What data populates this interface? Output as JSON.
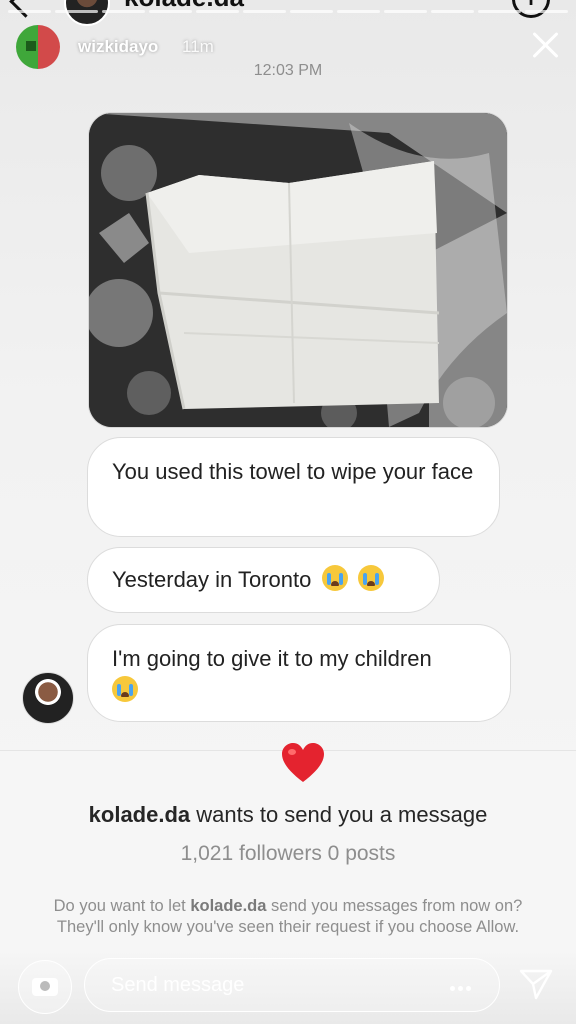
{
  "dm_header": {
    "username": "kolade.da",
    "info_label": "i"
  },
  "story": {
    "username": "wizkidayo",
    "time_ago": "11m"
  },
  "thread": {
    "timestamp": "12:03 PM",
    "messages": [
      {
        "text": "You used this towel to wipe your face"
      },
      {
        "text": "Yesterday in Toronto"
      },
      {
        "text": "I'm going to give it to my children"
      }
    ]
  },
  "request": {
    "username": "kolade.da",
    "title_suffix": "wants to send you a message",
    "stats": "1,021 followers 0 posts",
    "desc_prefix": "Do you want to let",
    "desc_suffix": "send you messages from now on? They'll only know you've seen their request if you choose Allow."
  },
  "reply": {
    "placeholder": "Send message"
  },
  "colors": {
    "heart": "#e4232f",
    "emoji": "#f7c83b",
    "bubble_border": "#dcdcdc"
  }
}
